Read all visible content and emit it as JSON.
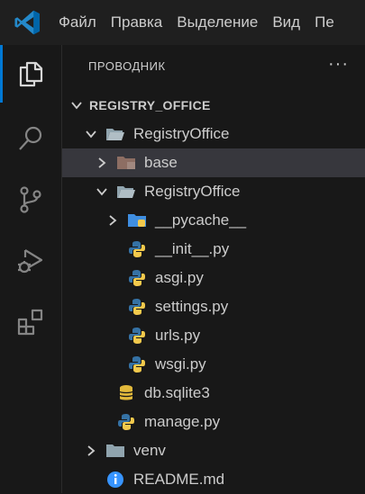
{
  "menu": {
    "items": [
      "Файл",
      "Правка",
      "Выделение",
      "Вид",
      "Пе"
    ]
  },
  "activity_bar": {
    "icons": [
      "explorer-icon",
      "search-icon",
      "source-control-icon",
      "run-debug-icon",
      "extensions-icon"
    ],
    "active": "explorer-icon"
  },
  "explorer": {
    "title": "ПРОВОДНИК",
    "more": "···",
    "root_label": "REGISTRY_OFFICE",
    "tree": [
      {
        "label": "RegistryOffice",
        "type": "folder-open"
      },
      {
        "label": "base",
        "type": "folder-collapsed"
      },
      {
        "label": "RegistryOffice",
        "type": "folder-open"
      },
      {
        "label": "__pycache__",
        "type": "folder-collapsed"
      },
      {
        "label": "__init__.py",
        "type": "python"
      },
      {
        "label": "asgi.py",
        "type": "python"
      },
      {
        "label": "settings.py",
        "type": "python"
      },
      {
        "label": "urls.py",
        "type": "python"
      },
      {
        "label": "wsgi.py",
        "type": "python"
      },
      {
        "label": "db.sqlite3",
        "type": "database"
      },
      {
        "label": "manage.py",
        "type": "python"
      },
      {
        "label": "venv",
        "type": "folder-collapsed"
      },
      {
        "label": "README.md",
        "type": "info"
      }
    ]
  },
  "colors": {
    "accent": "#0078d4",
    "python_blue": "#3572a5",
    "python_yellow": "#f2c94c",
    "db_yellow": "#e2b93b",
    "info_blue": "#3794ff"
  }
}
